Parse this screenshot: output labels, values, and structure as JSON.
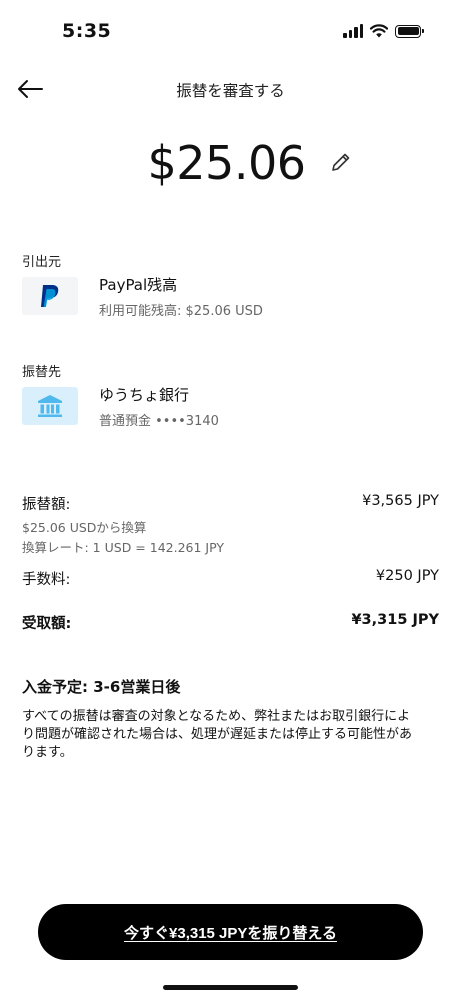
{
  "status_bar": {
    "time": "5:35"
  },
  "header": {
    "title": "振替を審査する"
  },
  "amount": {
    "value": "$25.06"
  },
  "from": {
    "label": "引出元",
    "name": "PayPal残高",
    "detail": "利用可能残高: $25.06 USD",
    "icon": "paypal-logo-icon"
  },
  "to": {
    "label": "振替先",
    "name": "ゆうちょ銀行",
    "detail": "普通預金 ••••3140",
    "icon": "bank-icon"
  },
  "breakdown": {
    "transfer_label": "振替額:",
    "transfer_value": "¥3,565 JPY",
    "conversion_note": "$25.06 USDから換算",
    "rate_note": "換算レート: 1 USD = 142.261 JPY",
    "fee_label": "手数料:",
    "fee_value": "¥250 JPY",
    "receive_label": "受取額:",
    "receive_value": "¥3,315 JPY"
  },
  "eta": "入金予定: 3-6営業日後",
  "disclaimer": "すべての振替は審査の対象となるため、弊社またはお取引銀行により問題が確認された場合は、処理が遅延または停止する可能性があります。",
  "cta": {
    "label": "今すぐ¥3,315 JPYを振り替える"
  },
  "colors": {
    "paypal_dark": "#003087",
    "paypal_light": "#009CDE",
    "bank_bg": "#D9F0FC",
    "bank_icon": "#4FB8EC",
    "cta_bg": "#000000"
  }
}
